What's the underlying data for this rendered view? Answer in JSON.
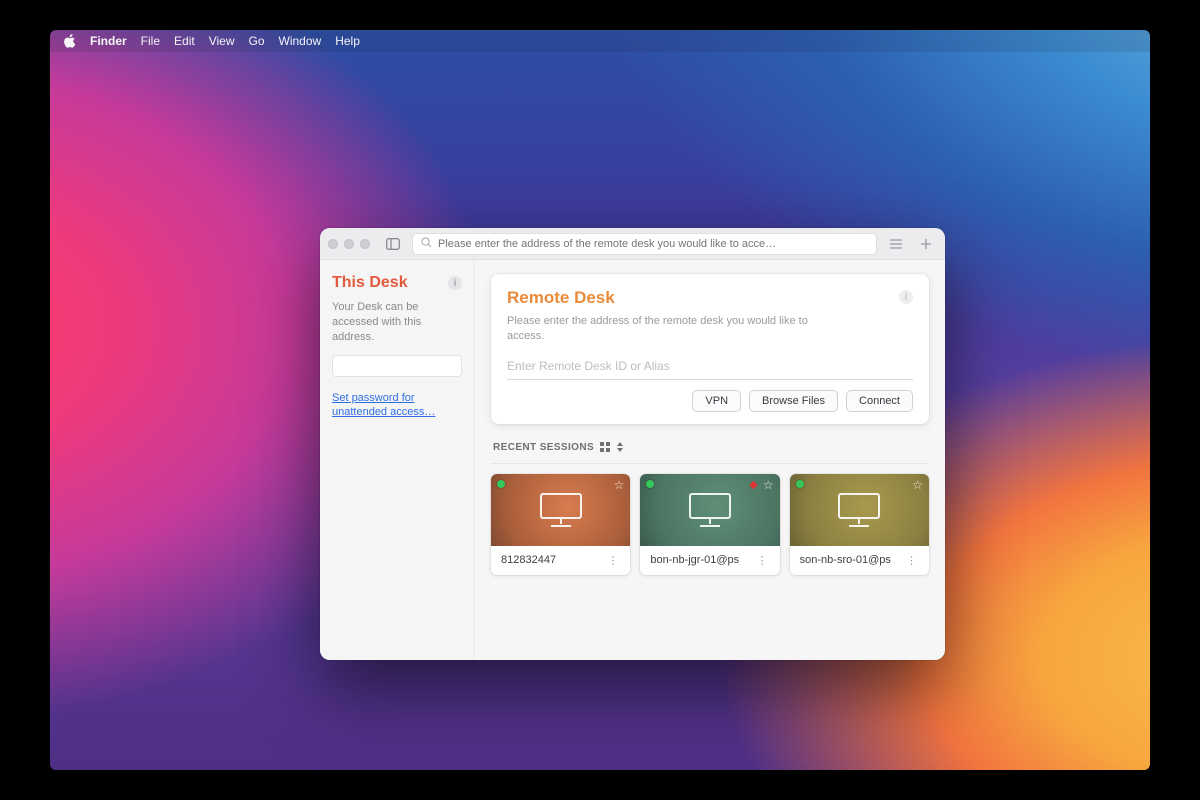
{
  "menubar": {
    "app": "Finder",
    "items": [
      "File",
      "Edit",
      "View",
      "Go",
      "Window",
      "Help"
    ]
  },
  "toolbar": {
    "search_placeholder": "Please enter the address of the remote desk you would like to acce…"
  },
  "sidebar": {
    "title": "This Desk",
    "description": "Your Desk can be accessed with this address.",
    "address_value": "",
    "password_link": "Set password for unattended access…"
  },
  "remote_card": {
    "title": "Remote Desk",
    "description": "Please enter the address of the remote desk you would like to access.",
    "input_placeholder": "Enter Remote Desk ID or Alias",
    "buttons": {
      "vpn": "VPN",
      "browse": "Browse Files",
      "connect": "Connect"
    }
  },
  "recent": {
    "heading": "RECENT SESSIONS",
    "items": [
      {
        "label": "812832447",
        "color": "orange",
        "flag": false
      },
      {
        "label": "bon-nb-jgr-01@ps",
        "color": "green",
        "flag": true
      },
      {
        "label": "son-nb-sro-01@ps",
        "color": "olive",
        "flag": false
      }
    ]
  }
}
